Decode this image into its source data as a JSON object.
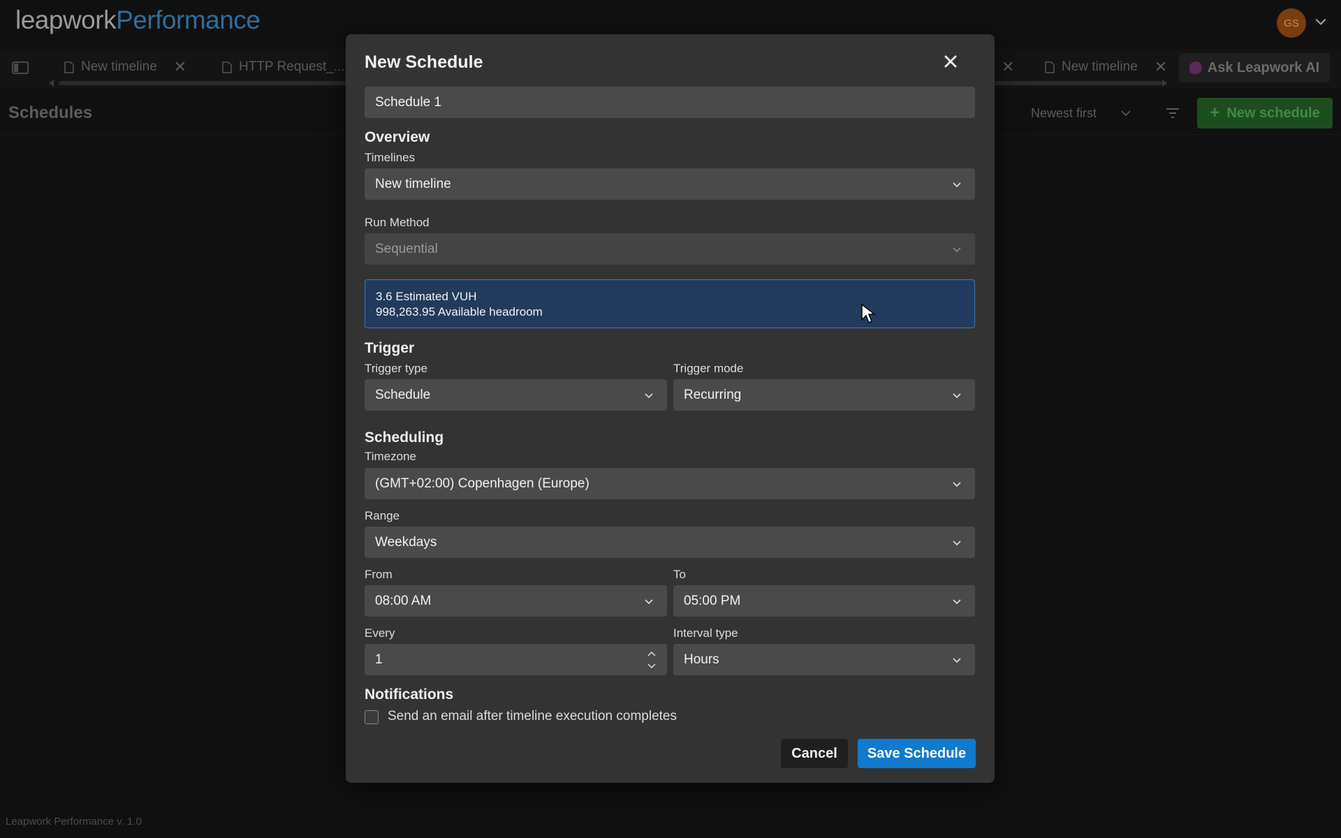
{
  "app": {
    "logo_part1": "leapwork",
    "logo_part2": "Performance",
    "avatar_initials": "GS",
    "version": "Leapwork Performance v. 1.0"
  },
  "tabs": [
    {
      "label": "New timeline"
    },
    {
      "label": "HTTP Request_..."
    },
    {
      "label": "New timeline"
    }
  ],
  "ask_ai_label": "Ask Leapwork AI",
  "page": {
    "title": "Schedules",
    "sort_value": "Newest first",
    "new_schedule_label": "New schedule"
  },
  "modal": {
    "title": "New Schedule",
    "name_value": "Schedule 1",
    "overview": {
      "heading": "Overview",
      "timelines_label": "Timelines",
      "timelines_value": "New timeline",
      "run_method_label": "Run Method",
      "run_method_value": "Sequential"
    },
    "info": {
      "line1": "3.6 Estimated VUH",
      "line2": "998,263.95 Available headroom"
    },
    "trigger": {
      "heading": "Trigger",
      "type_label": "Trigger type",
      "type_value": "Schedule",
      "mode_label": "Trigger mode",
      "mode_value": "Recurring"
    },
    "scheduling": {
      "heading": "Scheduling",
      "timezone_label": "Timezone",
      "timezone_value": "(GMT+02:00) Copenhagen (Europe)",
      "range_label": "Range",
      "range_value": "Weekdays",
      "from_label": "From",
      "from_value": "08:00 AM",
      "to_label": "To",
      "to_value": "05:00 PM",
      "every_label": "Every",
      "every_value": "1",
      "interval_label": "Interval type",
      "interval_value": "Hours"
    },
    "notifications": {
      "heading": "Notifications",
      "email_label": "Send an email after timeline execution completes",
      "email_checked": false
    },
    "cancel_label": "Cancel",
    "save_label": "Save Schedule"
  },
  "colors": {
    "accent_blue": "#0f7ad0",
    "success_green": "#1c4d1f",
    "info_bg": "#223b5c"
  }
}
